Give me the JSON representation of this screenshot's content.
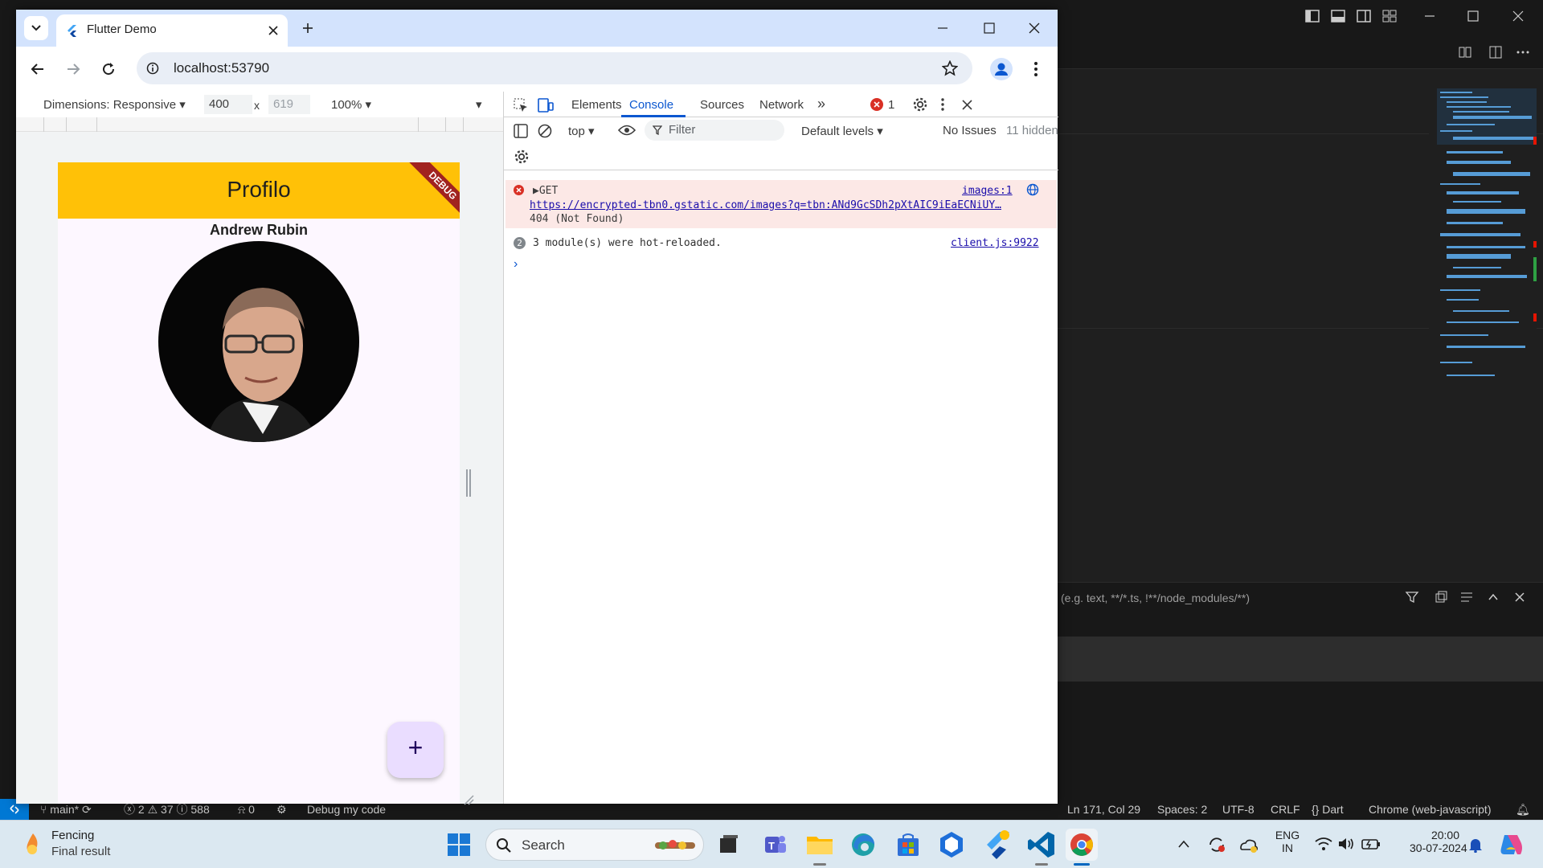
{
  "chrome": {
    "tab_title": "Flutter Demo",
    "url": "localhost:53790"
  },
  "device_toolbar": {
    "dimensions_label": "Dimensions: Responsive",
    "width": "400",
    "times": "x",
    "height": "619",
    "zoom": "100%"
  },
  "flutter_app": {
    "appbar_title": "Profilo",
    "debug_banner": "DEBUG",
    "name": "Andrew Rubin",
    "fab_label": "+"
  },
  "devtools": {
    "tabs": [
      "Elements",
      "Console",
      "Sources",
      "Network"
    ],
    "active_tab": "Console",
    "more_tabs": "»",
    "error_count": "1",
    "context": "top",
    "filter_placeholder": "Filter",
    "levels": "Default levels",
    "issues": "No Issues",
    "hidden": "11 hidden",
    "messages": [
      {
        "type": "error",
        "method": "GET",
        "url": "https://encrypted-tbn0.gstatic.com/images?q=tbn:ANd9GcSDh2pXtAIC9iEaECNiUY…",
        "status": "404 (Not Found)",
        "source": "images:1"
      },
      {
        "type": "info",
        "count": "2",
        "text": "3 module(s) were hot-reloaded.",
        "source": "client.js:9922"
      }
    ],
    "prompt": "›"
  },
  "vscode": {
    "panel_filter_placeholder": "(e.g. text, **/*.ts, !**/node_modules/**)",
    "status": {
      "branch": "main*",
      "errors": "2",
      "warnings": "37",
      "info": "588",
      "ports": "0",
      "debug": "Debug my code",
      "position": "Ln 171, Col 29",
      "spaces": "Spaces: 2",
      "encoding": "UTF-8",
      "eol": "CRLF",
      "language": "Dart",
      "device": "Chrome (web-javascript)"
    }
  },
  "taskbar": {
    "weather_title": "Fencing",
    "weather_sub": "Final result",
    "search_label": "Search",
    "lang_top": "ENG",
    "lang_bottom": "IN",
    "time": "20:00",
    "date": "30-07-2024"
  },
  "colors": {
    "appbar": "#ffc107",
    "fab": "#eaddff",
    "chrome_tabstrip": "#d3e3fd",
    "vscode_accent": "#0078d4",
    "error_bg": "#fce8e6"
  }
}
